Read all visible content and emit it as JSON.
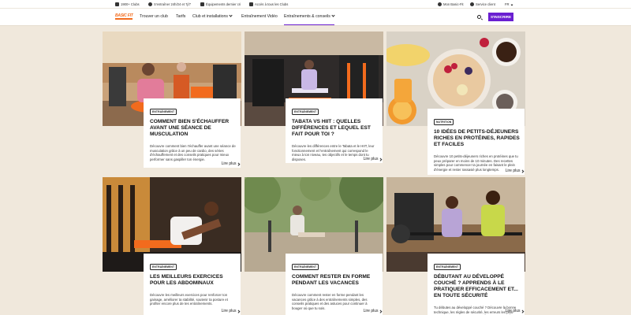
{
  "topbar": {
    "items": [
      {
        "label": "1900+ Clubs",
        "icon": "building-icon"
      },
      {
        "label": "S'entraîner 24h/24 et 7j/7",
        "icon": "clock-icon"
      },
      {
        "label": "Équipements dernier cri",
        "icon": "dumbbell-icon"
      },
      {
        "label": "Accès à tous les Clubs",
        "icon": "key-icon"
      }
    ],
    "account": "Mon Basic-Fit",
    "service": "Service client",
    "language": "FR"
  },
  "nav": {
    "logo": "BASIC FIT",
    "items": [
      "Trouver un club",
      "Tarifs",
      "Club et installations",
      "Entraînement Vidéo",
      "Entraînements & conseils"
    ],
    "signup": "S'INSCRIRE"
  },
  "cards": [
    {
      "tag": "Entraînement",
      "title": "Comment bien s'échauffer avant une séance de musculation",
      "desc": "Découvre comment bien t'échauffer avant une séance de musculation grâce à un peu de cardio, des séries d'échauffement et des conseils pratiques pour mieux performer sans gaspiller ton énergie.",
      "more": "Lire plus"
    },
    {
      "tag": "Entraînement",
      "title": "Tabata vs HIIT : quelles différences et lequel est fait pour toi ?",
      "desc": "Découvre les différences entre le Tabata et le HIIT, leur fonctionnement et l'entraînement qui correspond le mieux à ton niveau, tes objectifs et le temps dont tu disposes.",
      "more": "Lire plus"
    },
    {
      "tag": "Nutrition",
      "title": "10 idées de petits-déjeuners riches en protéines, rapides et faciles",
      "desc": "Découvre 10 petits-déjeuners riches en protéines que tu peux préparer en moins de 10 minutes. Des recettes simples pour commencer ta journée en faisant le plein d'énergie et rester rassasié plus longtemps.",
      "more": "Lire plus"
    },
    {
      "tag": "Entraînement",
      "title": "Les meilleurs exercices pour les abdominaux",
      "desc": "Découvre les meilleurs exercices pour renforcer ton gainage, améliorer ta stabilité, soutenir ta posture et profiter encore plus de tes entraînements.",
      "more": "Lire plus"
    },
    {
      "tag": "Entraînement",
      "title": "Comment rester en forme pendant les vacances",
      "desc": "Découvre comment rester en forme pendant les vacances grâce à des entraînements simples, des conseils pratiques et des astuces pour continuer à bouger où que tu sois.",
      "more": "Lire plus"
    },
    {
      "tag": "Entraînement",
      "title": "Débutant au développé couché ? Apprends à le pratiquer efficacement et... en toute sécurité",
      "desc": "Tu débutes au développé couché ? Découvre la bonne technique, les règles de sécurité, les erreurs les plus courantes et comment gagner en force et en muscle en toute confiance.",
      "more": "Lire plus"
    }
  ],
  "colors": {
    "brand_orange": "#f26b1d",
    "brand_purple": "#6a1fd1",
    "background": "#f0e8dc"
  }
}
